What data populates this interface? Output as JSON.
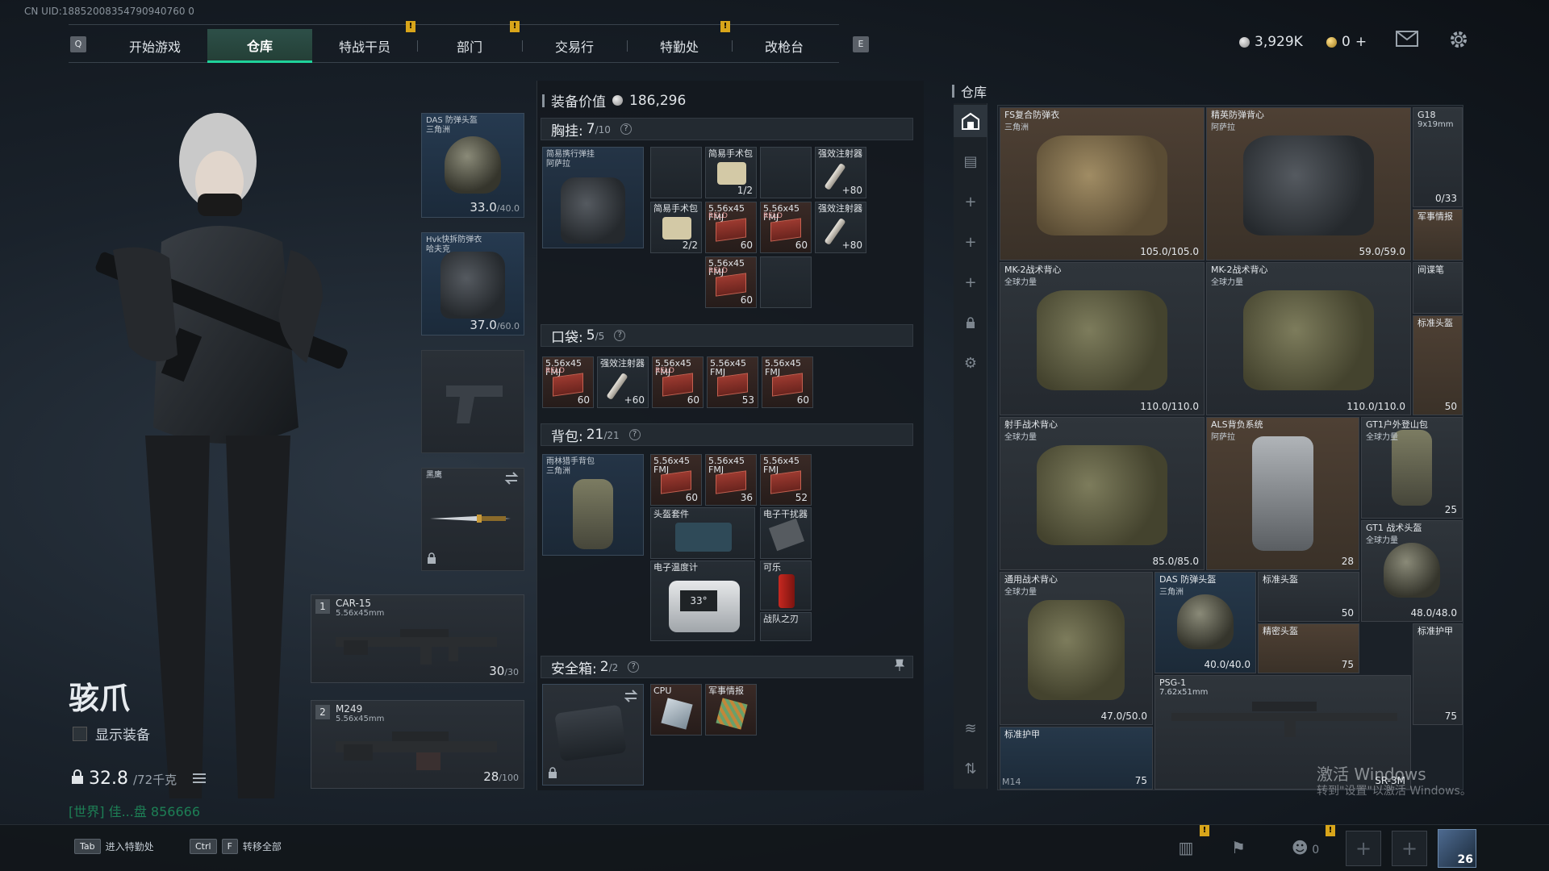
{
  "uid": "CN UID:18852008354790940760 0",
  "nav": {
    "key_left": "Q",
    "key_right": "E",
    "tabs": [
      "开始游戏",
      "仓库",
      "特战干员",
      "部门",
      "交易行",
      "特勤处",
      "改枪台"
    ],
    "active_tab": "仓库",
    "notices": [
      "!",
      "!",
      "!"
    ]
  },
  "currency": {
    "silver": "3,929K",
    "gold": "0"
  },
  "currency_plus": "+",
  "character": {
    "name": "骇爪",
    "show_equip_label": "显示装备",
    "weight": "32.8",
    "weight_max": "/72千克",
    "chat": "[世界] 佳...盘 856666"
  },
  "equip_slots": {
    "helmet": {
      "name": "DAS 防弹头盔",
      "sub": "三角洲",
      "dur": "33.0",
      "dur_max": "/40.0"
    },
    "armor": {
      "name": "Hvk快拆防弹衣",
      "sub": "哈夫克",
      "dur": "37.0",
      "dur_max": "/60.0"
    },
    "melee": {
      "name": "黑鹰"
    },
    "primary1": {
      "idx": "1",
      "name": "CAR-15",
      "cal": "5.56x45mm",
      "ammo": "30",
      "ammo_max": "/30"
    },
    "primary2": {
      "idx": "2",
      "name": "M249",
      "cal": "5.56x45mm",
      "ammo": "28",
      "ammo_max": "/100"
    }
  },
  "equipment_value": {
    "label": "装备价值",
    "value": "186,296"
  },
  "chest_rig": {
    "label": "胸挂:",
    "count": "7",
    "max": "/10",
    "rig_name": "简易携行弹挂",
    "rig_sub": "阿萨拉",
    "items": [
      {
        "name": "简易手术包",
        "qty": "1/2"
      },
      {
        "name": "强效注射器",
        "qty": "+80"
      },
      {
        "name": "简易手术包",
        "qty": "2/2"
      },
      {
        "name": "5.56x45 FMJ",
        "rel": "RELD",
        "qty": "60"
      },
      {
        "name": "5.56x45 FMJ",
        "rel": "RELD",
        "qty": "60"
      },
      {
        "name": "强效注射器",
        "qty": "+80"
      },
      {
        "name": "5.56x45 FMJ",
        "rel": "RELD",
        "qty": "60"
      }
    ]
  },
  "pockets": {
    "label": "口袋:",
    "count": "5",
    "max": "/5",
    "items": [
      {
        "name": "5.56x45 FMJ",
        "rel": "RELD",
        "qty": "60"
      },
      {
        "name": "强效注射器",
        "qty": "+60"
      },
      {
        "name": "5.56x45 FMJ",
        "rel": "RELD",
        "qty": "60"
      },
      {
        "name": "5.56x45 FMJ",
        "qty": "53"
      },
      {
        "name": "5.56x45 FMJ",
        "qty": "60"
      }
    ]
  },
  "backpack": {
    "label": "背包:",
    "count": "21",
    "max": "/21",
    "bag_name": "雨林猎手背包",
    "bag_sub": "三角洲",
    "items": [
      {
        "name": "5.56x45 FMJ",
        "qty": "60"
      },
      {
        "name": "5.56x45 FMJ",
        "qty": "36"
      },
      {
        "name": "5.56x45 FMJ",
        "qty": "52"
      },
      {
        "name": "头盔套件"
      },
      {
        "name": "电子干扰器"
      },
      {
        "name": "电子温度计",
        "display": "33°"
      },
      {
        "name": "可乐"
      },
      {
        "name": "战队之刃"
      }
    ]
  },
  "safe_box": {
    "label": "安全箱:",
    "count": "2",
    "max": "/2",
    "items": [
      {
        "name": "CPU"
      },
      {
        "name": "军事情报"
      }
    ]
  },
  "warehouse": {
    "title": "仓库",
    "items": [
      {
        "name": "FS复合防弹衣",
        "sub": "三角洲",
        "dur": "105.0/105.0"
      },
      {
        "name": "精英防弹背心",
        "sub": "阿萨拉",
        "dur": "59.0/59.0"
      },
      {
        "name": "G18",
        "sub": "9x19mm",
        "dur": "0/33"
      },
      {
        "name": "军事情报"
      },
      {
        "name": "MK-2战术背心",
        "sub": "全球力量",
        "dur": "110.0/110.0"
      },
      {
        "name": "MK-2战术背心",
        "sub": "全球力量",
        "dur": "110.0/110.0"
      },
      {
        "name": "间谍笔"
      },
      {
        "name": "标准头盔",
        "dur": "50"
      },
      {
        "name": "射手战术背心",
        "sub": "全球力量",
        "dur": "85.0/85.0"
      },
      {
        "name": "ALS背负系统",
        "sub": "阿萨拉",
        "dur": "28"
      },
      {
        "name": "GT1户外登山包",
        "sub": "全球力量",
        "dur": "25"
      },
      {
        "name": "GT1 战术头盔",
        "sub": "全球力量",
        "dur": "48.0/48.0"
      },
      {
        "name": "通用战术背心",
        "sub": "全球力量",
        "dur": "47.0/50.0"
      },
      {
        "name": "DAS 防弹头盔",
        "sub": "三角洲",
        "dur": "40.0/40.0"
      },
      {
        "name": "标准头盔",
        "dur": "50"
      },
      {
        "name": "精密头盔",
        "dur": "75"
      },
      {
        "name": "标准护甲"
      },
      {
        "name": "PSG-1",
        "sub": "7.62x51mm",
        "dur": "SR-3M"
      },
      {
        "name": "标准护甲",
        "dur": "75"
      },
      {
        "name": "M14"
      }
    ],
    "extra_dur": "75"
  },
  "watermark": {
    "line1": "激活 Windows",
    "line2": "转到\"设置\"以激活 Windows。"
  },
  "bottom": {
    "hint1_key": "Tab",
    "hint1_label": "进入特勤处",
    "hint2_key1": "Ctrl",
    "hint2_key2": "F",
    "hint2_label": "转移全部",
    "friends_count": "0",
    "level": "26"
  },
  "icons": {
    "warehouse_tab": "warehouse-icon",
    "mail": "mail-icon",
    "settings": "gear-icon",
    "swap": "swap-icon",
    "lock": "lock-icon",
    "pin": "pin-icon"
  },
  "colors": {
    "accent": "#1fd29a",
    "notice": "#d8a51a",
    "ammo_box": "#9c3a30"
  }
}
